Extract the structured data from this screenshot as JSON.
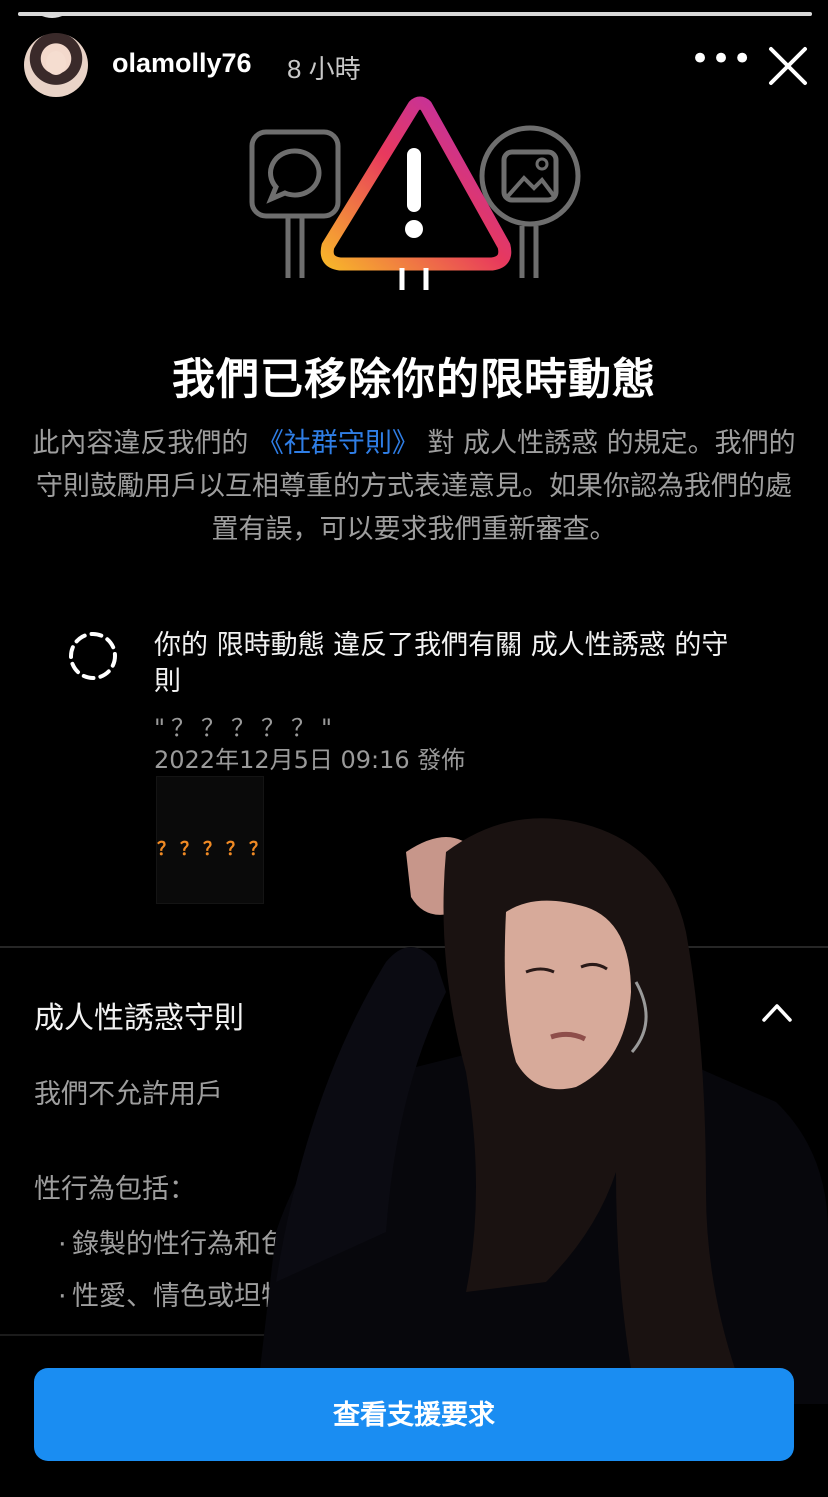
{
  "story": {
    "username": "olamolly76",
    "timestamp": "8 小時",
    "progress": 1.0
  },
  "icons": {
    "more": "more-horizontal-icon",
    "close": "close-icon",
    "violation": "dashed-circle-icon",
    "chevron": "chevron-up-icon"
  },
  "notice": {
    "headline": "我們已移除你的限時動態",
    "body_part1": "此內容違反我們的 ",
    "body_link": "《社群守則》",
    "body_part2": " 對 成人性誘惑 的規定。我們的守則鼓勵用戶以互相尊重的方式表達意見。如果你認為我們的處置有誤，可以要求我們重新審查。"
  },
  "violation": {
    "text": "你的 限時動態 違反了我們有關 成人性誘惑 的守則",
    "quote": "\"？？？？？\"",
    "date": "2022年12月5日 09:16 發佈",
    "thumbnail_text": "？？？？？"
  },
  "guideline": {
    "title": "成人性誘惑守則",
    "paragraph_1": "我們不允許用戶",
    "paragraph_2": "性行為包括：",
    "bullets": [
      "錄製的性行為和色情內容",
      "性愛、情色或坦特羅相關的"
    ]
  },
  "action": {
    "button_label": "查看支援要求"
  },
  "colors": {
    "accent": "#1a8df2",
    "link": "#2f7ee6",
    "background": "#000000",
    "warning_gradient": [
      "#f7b32b",
      "#e8395d",
      "#b22dbd"
    ]
  }
}
